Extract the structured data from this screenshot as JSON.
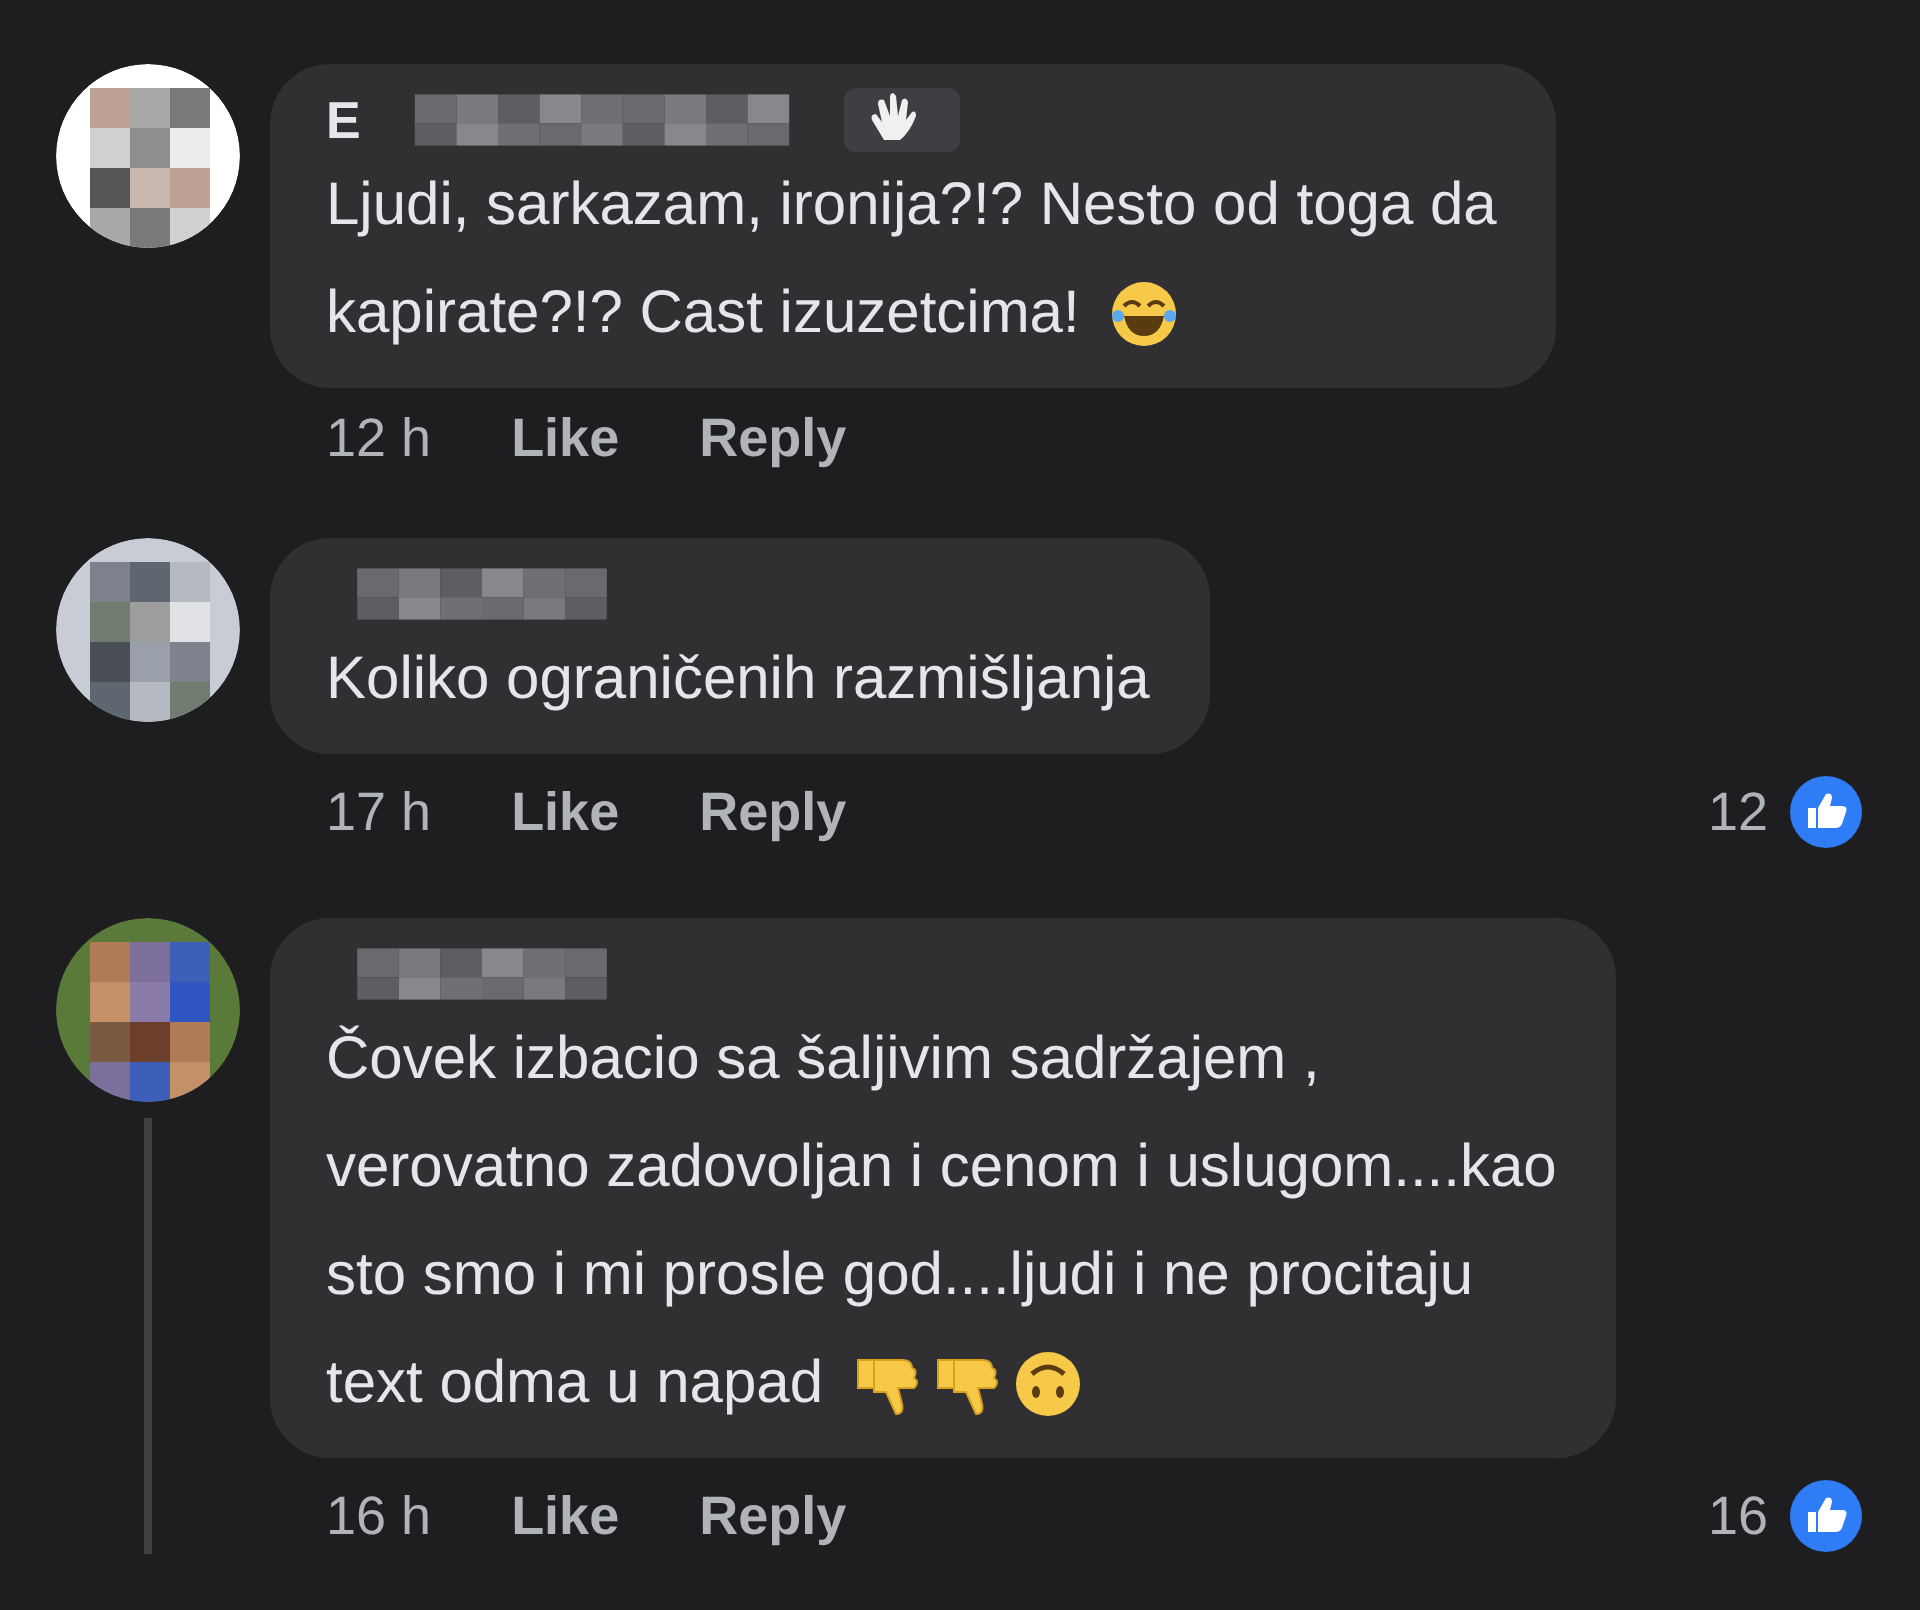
{
  "comments": [
    {
      "name_visible": "E",
      "name_badge": {
        "kind": "wave"
      },
      "lines": [
        "Ljudi, sarkazam, ironija?!? Nesto od toga da",
        "kapirate?!? Cast izuzetcima!"
      ],
      "emojis": [
        {
          "kind": "laughing"
        }
      ],
      "time": "12 h",
      "like": "Like",
      "reply": "Reply",
      "thread_line": false
    },
    {
      "lines": [
        "Koliko ograničenih razmišljanja"
      ],
      "time": "17 h",
      "like": "Like",
      "reply": "Reply",
      "reactions": "12",
      "thread_line": false
    },
    {
      "lines": [
        "Čovek izbacio sa šaljivim sadržajem ,",
        "verovatno zadovoljan i cenom i uslugom....kao",
        "sto smo i mi prosle god....ljudi i ne procitaju",
        "text odma u napad"
      ],
      "emojis": [
        {
          "kind": "thumbs_down"
        },
        {
          "kind": "thumbs_down"
        },
        {
          "kind": "upside_down"
        }
      ],
      "time": "16 h",
      "like": "Like",
      "reply": "Reply",
      "reactions": "16",
      "thread_line": true
    }
  ]
}
